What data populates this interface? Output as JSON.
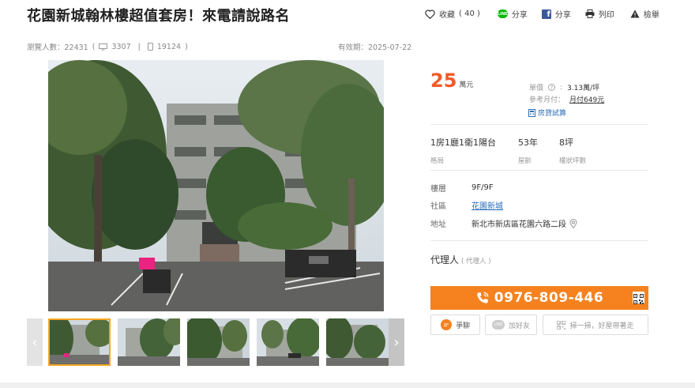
{
  "title": "花園新城翰林樓超值套房！來電請說路名",
  "actions": {
    "favorite_label": "收藏",
    "favorite_count": "( 40 )",
    "line_share": "分享",
    "fb_share": "分享",
    "print": "列印",
    "report": "檢舉"
  },
  "stats": {
    "views_label": "瀏覽人數：22431",
    "pc_views": "3307",
    "mobile_views": "19124"
  },
  "valid_until": "有效期：2025-07-22",
  "price": {
    "amount": "25",
    "unit": "萬元",
    "unit_price_label": "單價",
    "unit_price_value": "3.13萬/坪",
    "monthly_label": "參考月付：",
    "monthly_value": "月付649元",
    "loan_link": "房貸試算"
  },
  "specs": [
    {
      "value": "1房1廳1衛1陽台",
      "label": "格局"
    },
    {
      "value": "53年",
      "label": "屋齡"
    },
    {
      "value": "8坪",
      "label": "權狀坪數"
    }
  ],
  "details": {
    "floor_label": "樓層",
    "floor_value": "9F/9F",
    "community_label": "社區",
    "community_value": "花園新城",
    "address_label": "地址",
    "address_value": "新北市新店區花園六路二段"
  },
  "agent": {
    "label": "代理人",
    "sub": "( 代理人 )"
  },
  "phone": "0976-809-446",
  "buttons": {
    "ask": "爭聊",
    "add_friend": "加好友",
    "scan": "掃一掃，好屋帶著走"
  },
  "colors": {
    "accent_orange": "#f5821f",
    "price_red": "#f05a28",
    "link_blue": "#2c6fb7",
    "line_green": "#00b900",
    "fb_blue": "#3b5998"
  }
}
